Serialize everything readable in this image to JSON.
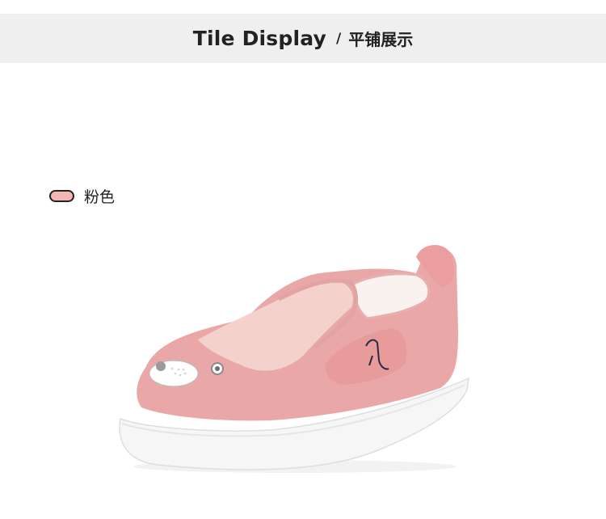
{
  "header": {
    "title_en": "Tile Display",
    "separator": "/",
    "title_cn": "平铺展示"
  },
  "color_option": {
    "label": "粉色",
    "swatch_color": "#f2b6b3"
  },
  "product_image": {
    "icon": "pink-slip-on-shoe"
  }
}
